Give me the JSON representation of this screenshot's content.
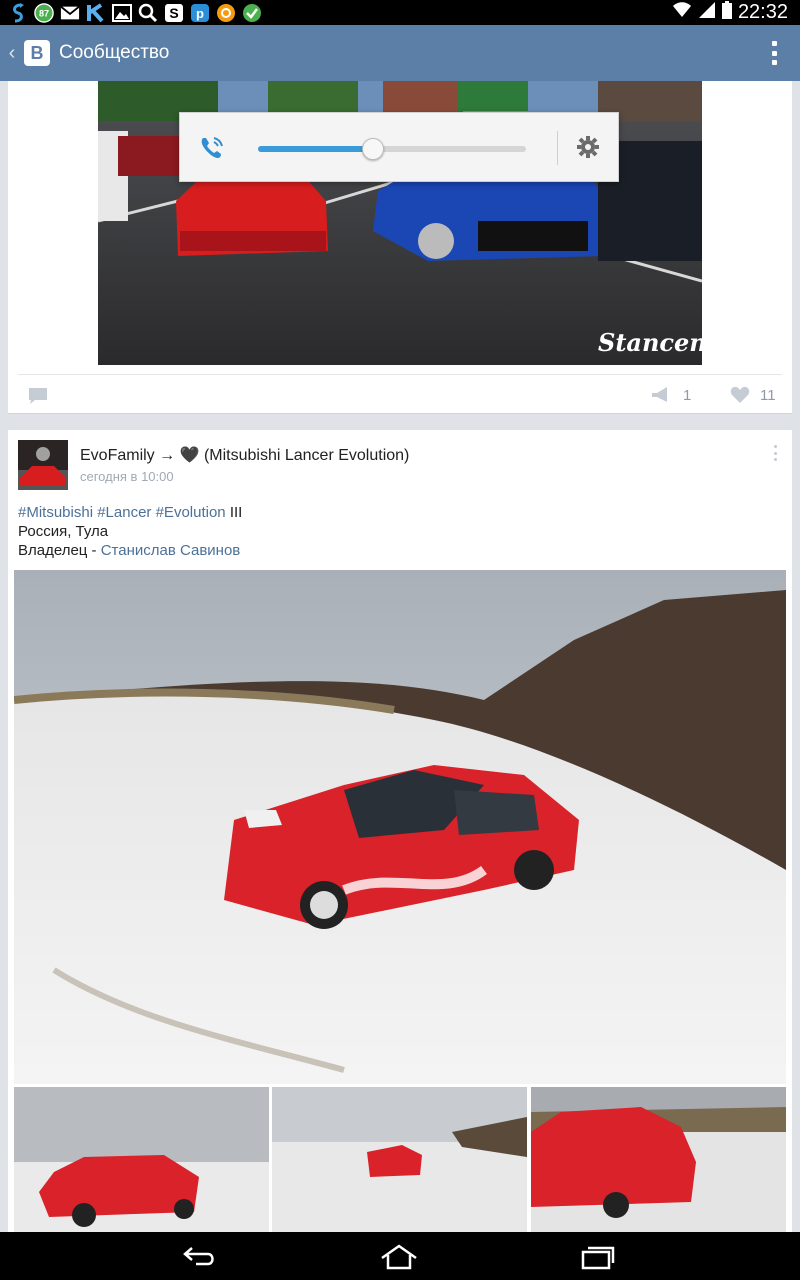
{
  "status_bar": {
    "time": "22:32",
    "badge_value": "87",
    "icons": [
      "sync-icon",
      "badge-icon",
      "mail-icon",
      "k-app-icon",
      "image-icon",
      "search-icon",
      "skype-icon",
      "p-app-icon",
      "odnoklassniki-icon",
      "checkmark-icon",
      "wifi-icon",
      "signal-icon",
      "battery-icon"
    ]
  },
  "app_bar": {
    "logo_letter": "В",
    "title": "Сообщество",
    "color": "#5b7fa6"
  },
  "post1": {
    "watermark": "Stancenation",
    "shares": "1",
    "likes": "11"
  },
  "volume_popup": {
    "level": 0.43,
    "accent": "#3a9bd8"
  },
  "post2": {
    "author_prefix": "EvoFamily → ",
    "author_suffix": " (Mitsubishi Lancer Evolution)",
    "time": "сегодня в 10:00",
    "hashtags": [
      "#Mitsubishi",
      "#Lancer",
      "#Evolution"
    ],
    "hashtag_suffix": " III",
    "location": "Россия, Тула",
    "owner_label": "Владелец - ",
    "owner_name": "Станислав Савинов"
  },
  "nav_bar": {
    "buttons": [
      "back-icon",
      "home-icon",
      "recents-icon"
    ]
  }
}
